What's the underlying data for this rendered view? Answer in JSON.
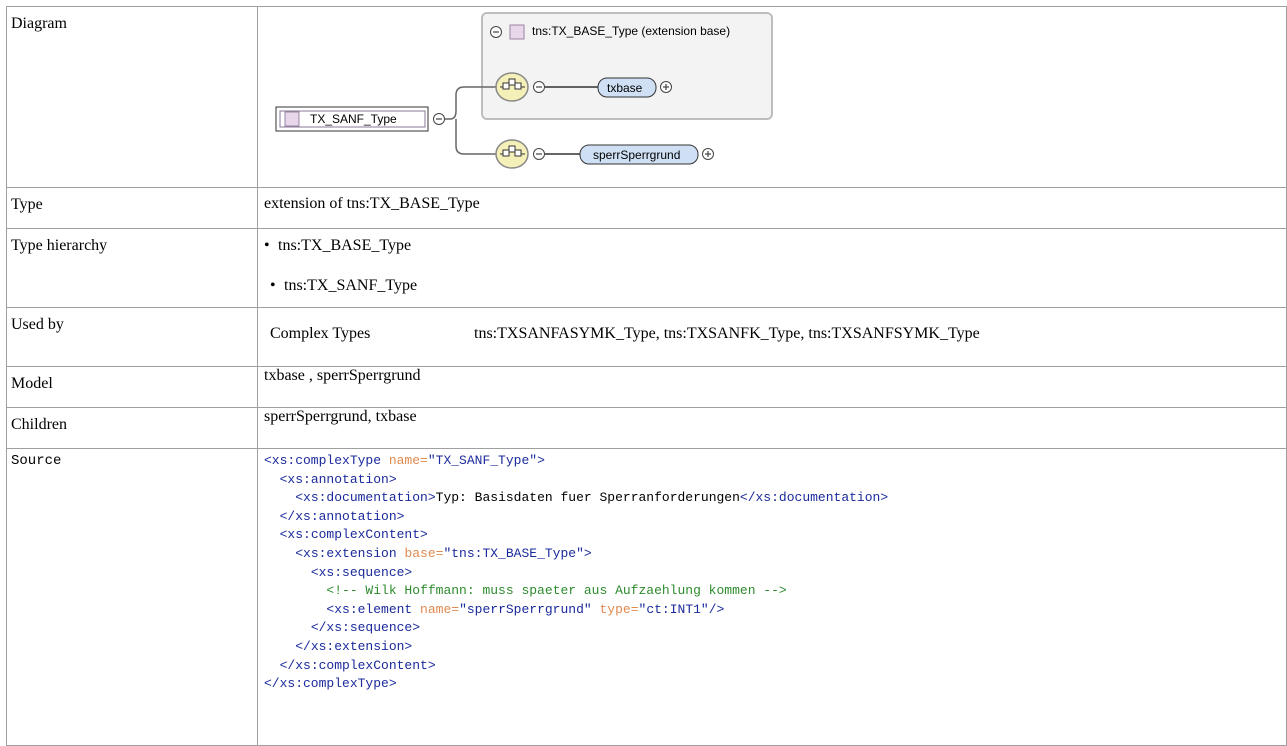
{
  "rows": {
    "diagram": {
      "label": "Diagram"
    },
    "type": {
      "label": "Type",
      "value": "extension of tns:TX_BASE_Type"
    },
    "hierarchy": {
      "label": "Type hierarchy",
      "items": [
        "tns:TX_BASE_Type",
        "tns:TX_SANF_Type"
      ]
    },
    "used_by": {
      "label": "Used by",
      "category": "Complex Types",
      "value": "tns:TXSANFASYMK_Type, tns:TXSANFK_Type, tns:TXSANFSYMK_Type"
    },
    "model": {
      "label": "Model",
      "value": "txbase , sperrSperrgrund"
    },
    "children": {
      "label": "Children",
      "value": "sperrSperrgrund, txbase"
    },
    "source": {
      "label": "Source"
    }
  },
  "diagram": {
    "root_type": "TX_SANF_Type",
    "base_group": "tns:TX_BASE_Type (extension base)",
    "element_1": "txbase",
    "element_2": "sperrSperrgrund"
  },
  "source_lines": [
    [
      [
        "tag",
        "<xs:complexType "
      ],
      [
        "att",
        "name="
      ],
      [
        "str",
        "\"TX_SANF_Type\""
      ],
      [
        "tag",
        ">"
      ]
    ],
    [
      [
        "txt",
        "  "
      ],
      [
        "tag",
        "<xs:annotation>"
      ]
    ],
    [
      [
        "txt",
        "    "
      ],
      [
        "tag",
        "<xs:documentation>"
      ],
      [
        "txt",
        "Typ: Basisdaten fuer Sperranforderungen"
      ],
      [
        "tag",
        "</xs:documentation>"
      ]
    ],
    [
      [
        "txt",
        "  "
      ],
      [
        "tag",
        "</xs:annotation>"
      ]
    ],
    [
      [
        "txt",
        "  "
      ],
      [
        "tag",
        "<xs:complexContent>"
      ]
    ],
    [
      [
        "txt",
        "    "
      ],
      [
        "tag",
        "<xs:extension "
      ],
      [
        "att",
        "base="
      ],
      [
        "str",
        "\"tns:TX_BASE_Type\""
      ],
      [
        "tag",
        ">"
      ]
    ],
    [
      [
        "txt",
        "      "
      ],
      [
        "tag",
        "<xs:sequence>"
      ]
    ],
    [
      [
        "txt",
        "        "
      ],
      [
        "cmt",
        "<!-- Wilk Hoffmann: muss spaeter aus Aufzaehlung kommen -->"
      ]
    ],
    [
      [
        "txt",
        "        "
      ],
      [
        "tag",
        "<xs:element "
      ],
      [
        "att",
        "name="
      ],
      [
        "str",
        "\"sperrSperrgrund\" "
      ],
      [
        "att",
        "type="
      ],
      [
        "str",
        "\"ct:INT1\""
      ],
      [
        "tag",
        "/>"
      ]
    ],
    [
      [
        "txt",
        "      "
      ],
      [
        "tag",
        "</xs:sequence>"
      ]
    ],
    [
      [
        "txt",
        "    "
      ],
      [
        "tag",
        "</xs:extension>"
      ]
    ],
    [
      [
        "txt",
        "  "
      ],
      [
        "tag",
        "</xs:complexContent>"
      ]
    ],
    [
      [
        "tag",
        "</xs:complexType>"
      ]
    ]
  ],
  "colors": {
    "tag": "#1b2a9c",
    "attribute": "#e08a4e",
    "comment": "#2e8b2e",
    "element_fill": "#cfe0f5",
    "type_box_fill": "#e8d6ea",
    "sequence_fill": "#f7f3c0"
  }
}
